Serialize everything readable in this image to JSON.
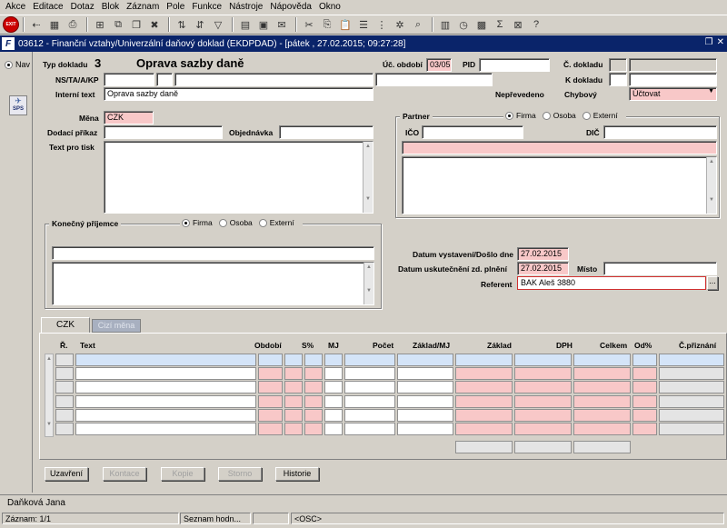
{
  "menu": [
    "Akce",
    "Editace",
    "Dotaz",
    "Blok",
    "Záznam",
    "Pole",
    "Funkce",
    "Nástroje",
    "Nápověda",
    "Okno"
  ],
  "toolbar": {
    "exit_label": "EXIT"
  },
  "window": {
    "title": "03612 - Finanční vztahy/Univerzální daňový doklad (EKDPDAD) - [pátek  , 27.02.2015; 09:27:28]"
  },
  "left": {
    "nav_label": "Nav",
    "sps_label": "SPS"
  },
  "header": {
    "typ_dokladu_label": "Typ dokladu",
    "typ_dokladu_value": "3",
    "typ_dokladu_name": "Oprava sazby daně",
    "uc_obdobi_label": "Úč. období",
    "uc_obdobi_value": "03/05",
    "pid_label": "PID",
    "pid_value": "",
    "c_dokladu_label": "Č. dokladu",
    "k_dokladu_label": "K dokladu",
    "ns_label": "NS/TA/A/KP",
    "interni_text_label": "Interní text",
    "interni_text_value": "Oprava sazby daně",
    "neprevedeno_label": "Nepřevedeno",
    "chybovy_label": "Chybový",
    "chybovy_value": "Účtovat"
  },
  "form": {
    "mena_label": "Měna",
    "mena_value": "CZK",
    "dodaci_prikaz_label": "Dodací příkaz",
    "objednavka_label": "Objednávka",
    "text_pro_tisk_label": "Text pro tisk"
  },
  "partner": {
    "title": "Partner",
    "options": [
      "Firma",
      "Osoba",
      "Externí"
    ],
    "selected": "Firma",
    "ico_label": "IČO",
    "dic_label": "DIČ"
  },
  "recipient": {
    "title": "Konečný příjemce",
    "options": [
      "Firma",
      "Osoba",
      "Externí"
    ],
    "selected": "Firma"
  },
  "dates": {
    "vystaveni_label": "Datum vystavení/Došlo dne",
    "vystaveni_value": "27.02.2015",
    "plneni_label": "Datum uskutečnění zd. plnění",
    "plneni_value": "27.02.2015",
    "misto_label": "Místo",
    "referent_label": "Referent",
    "referent_value": "BAK Aleš 3880"
  },
  "tabs": [
    "CZK",
    "Cizí měna"
  ],
  "table": {
    "columns": [
      "Ř.",
      "Text",
      "Období",
      "S%",
      "MJ",
      "Počet",
      "Základ/MJ",
      "Základ",
      "DPH",
      "Celkem",
      "Od%",
      "Č.přiznání"
    ],
    "row_count": 6
  },
  "buttons": {
    "uzavreni": "Uzavření",
    "kontace": "Kontace",
    "kopie": "Kopie",
    "storno": "Storno",
    "historie": "Historie"
  },
  "status": {
    "user": "Daňková Jana",
    "record": "Záznam: 1/1",
    "list": "Seznam hodn...",
    "osc": "<OSC>"
  },
  "colors": {
    "title_bar": "#0a246a",
    "required_field": "#f8c8c8",
    "selected_row": "#d4e4f8"
  }
}
